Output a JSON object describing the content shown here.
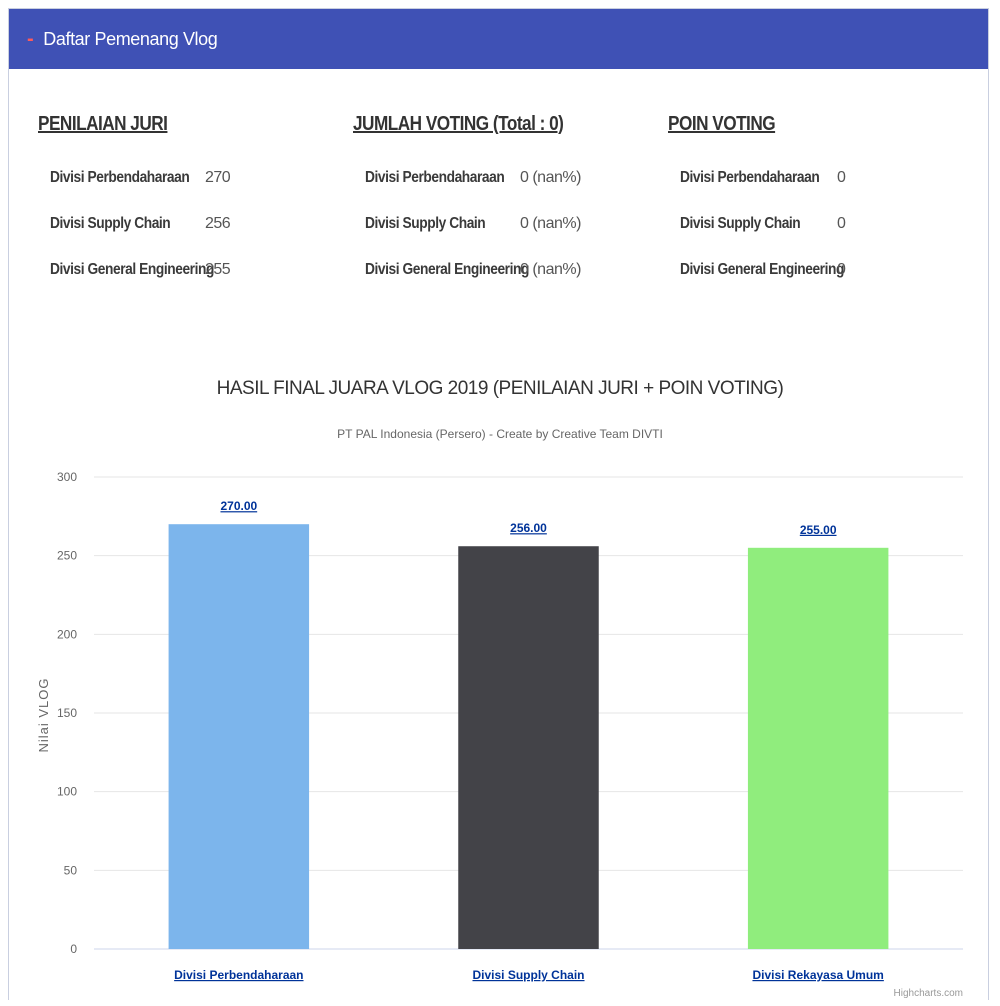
{
  "panel": {
    "title": "Daftar Pemenang Vlog"
  },
  "stats": {
    "juri": {
      "title": "PENILAIAN JURI",
      "rows": [
        {
          "label": "Divisi Perbendaharaan",
          "value": "270"
        },
        {
          "label": "Divisi Supply Chain",
          "value": "256"
        },
        {
          "label": "Divisi General Engineering",
          "value": "255"
        }
      ]
    },
    "voting": {
      "title": "JUMLAH VOTING (Total : 0)",
      "rows": [
        {
          "label": "Divisi Perbendaharaan",
          "value": "0 (nan%)"
        },
        {
          "label": "Divisi Supply Chain",
          "value": "0 (nan%)"
        },
        {
          "label": "Divisi General Engineering",
          "value": "0 (nan%)"
        }
      ]
    },
    "poin": {
      "title": "POIN VOTING",
      "rows": [
        {
          "label": "Divisi Perbendaharaan",
          "value": "0"
        },
        {
          "label": "Divisi Supply Chain",
          "value": "0"
        },
        {
          "label": "Divisi General Engineering",
          "value": "0"
        }
      ]
    }
  },
  "chart_data": {
    "type": "bar",
    "title": "HASIL FINAL JUARA VLOG 2019 (PENILAIAN JURI + POIN VOTING)",
    "subtitle": "PT PAL Indonesia (Persero) - Create by Creative Team DIVTI",
    "xlabel": "",
    "ylabel": "Nilai VLOG",
    "categories": [
      "Divisi Perbendaharaan",
      "Divisi Supply Chain",
      "Divisi Rekayasa Umum"
    ],
    "values": [
      270,
      256,
      255
    ],
    "data_labels": [
      "270.00",
      "256.00",
      "255.00"
    ],
    "colors": [
      "#7cb5ec",
      "#434348",
      "#90ed7d"
    ],
    "ylim": [
      0,
      300
    ],
    "yticks": [
      0,
      50,
      100,
      150,
      200,
      250,
      300
    ],
    "grid": true,
    "legend": "none",
    "credit": "Highcharts.com"
  },
  "colors": {
    "header": "#3f51b5",
    "collapse_icon": "#ff5a5a"
  }
}
